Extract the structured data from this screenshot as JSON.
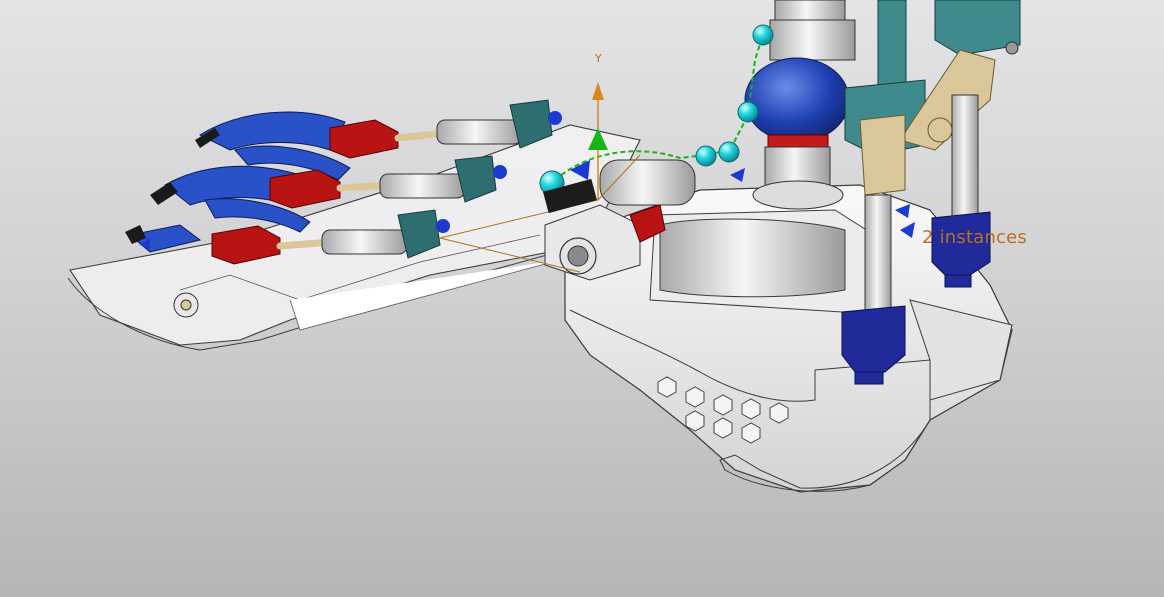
{
  "viewport": {
    "axis_label": "Y",
    "annotation_label": "2 instances"
  },
  "colors": {
    "background_top": "#e4e4e6",
    "background_bottom": "#b6b6b8",
    "part_body": "#f0f0f2",
    "part_edge": "#3c3c3c",
    "blue_parts": "#2a52c8",
    "red_parts": "#b81414",
    "teal_parts": "#3f8a8c",
    "tan_parts": "#d9c79a",
    "navy_parts": "#202a9a",
    "cyan_handles": "#22d8e0",
    "axis_color": "#d58a1e",
    "triad_green": "#18b418",
    "annotation_color": "#b87020"
  }
}
